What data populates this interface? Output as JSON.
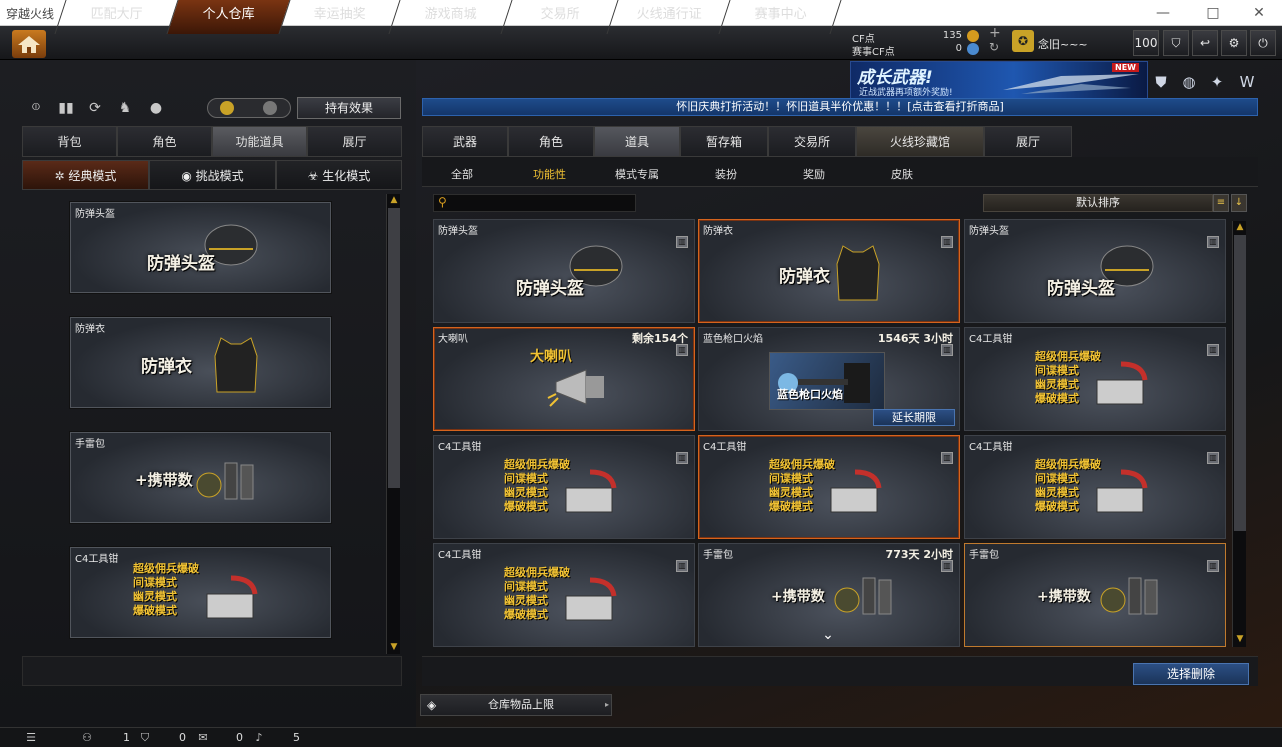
{
  "window": {
    "title": "穿越火线",
    "minimize": "—",
    "maximize": "□",
    "close": "✕"
  },
  "nav": {
    "home_icon": "home-icon",
    "tabs": [
      "匹配大厅",
      "个人仓库",
      "幸运抽奖",
      "游戏商城",
      "交易所",
      "火线通行证",
      "赛事中心"
    ],
    "active": "个人仓库"
  },
  "currency": {
    "cf_label": "CF点",
    "cf_value": "135",
    "event_label": "赛事CF点",
    "event_value": "0",
    "plus": "+",
    "refresh": "↻"
  },
  "user": {
    "name": "念旧~~~",
    "level": "100"
  },
  "toolbar": {
    "icons": [
      "shield-icon",
      "return-icon",
      "gear-icon",
      "power-icon"
    ]
  },
  "banner": {
    "title": "成长武器!",
    "subtitle": "近战武器再项额外奖励!",
    "badge": "NEW"
  },
  "left": {
    "effect_button": "持有效果",
    "tabs": [
      "背包",
      "角色",
      "功能道具",
      "展厅"
    ],
    "active_tab": "功能道具",
    "modes": [
      "经典模式",
      "挑战模式",
      "生化模式"
    ],
    "active_mode": "经典模式",
    "cards": [
      {
        "name": "防弹头盔",
        "title": "防弹头盔"
      },
      {
        "name": "防弹衣",
        "title": "防弹衣"
      },
      {
        "name": "手雷包",
        "title": "+携带数"
      },
      {
        "name": "C4工具钳",
        "lines": [
          "超级佣兵爆破",
          "间谍模式",
          "幽灵模式",
          "爆破模式"
        ]
      }
    ]
  },
  "notice": "怀旧庆典打折活动！！怀旧道具半价优惠！！！[点击查看打折商品]",
  "right": {
    "tabs": [
      "武器",
      "角色",
      "道具",
      "暂存箱",
      "交易所",
      "火线珍藏馆",
      "展厅"
    ],
    "active_tab": "道具",
    "subtabs": [
      "全部",
      "功能性",
      "模式专属",
      "装扮",
      "奖励",
      "皮肤"
    ],
    "active_subtab": "功能性",
    "search_placeholder": "",
    "sort_label": "默认排序",
    "items": [
      {
        "name": "防弹头盔",
        "big": "防弹头盔",
        "remain": ""
      },
      {
        "name": "防弹衣",
        "big": "防弹衣",
        "remain": ""
      },
      {
        "name": "防弹头盔",
        "big": "防弹头盔",
        "remain": ""
      },
      {
        "name": "大喇叭",
        "big": "大喇叭",
        "remain": "剩余154个"
      },
      {
        "name": "蓝色枪口火焰",
        "big": "蓝色枪口火焰",
        "remain": "1546天 3小时",
        "action": "延长期限"
      },
      {
        "name": "C4工具钳",
        "lines": [
          "超级佣兵爆破",
          "间谍模式",
          "幽灵模式",
          "爆破模式"
        ],
        "remain": ""
      },
      {
        "name": "C4工具钳",
        "lines": [
          "超级佣兵爆破",
          "间谍模式",
          "幽灵模式",
          "爆破模式"
        ],
        "remain": ""
      },
      {
        "name": "C4工具钳",
        "lines": [
          "超级佣兵爆破",
          "间谍模式",
          "幽灵模式",
          "爆破模式"
        ],
        "remain": ""
      },
      {
        "name": "C4工具钳",
        "lines": [
          "超级佣兵爆破",
          "间谍模式",
          "幽灵模式",
          "爆破模式"
        ],
        "remain": ""
      },
      {
        "name": "C4工具钳",
        "lines": [
          "超级佣兵爆破",
          "间谍模式",
          "幽灵模式",
          "爆破模式"
        ],
        "remain": ""
      },
      {
        "name": "手雷包",
        "big": "+携带数",
        "remain": "773天 2小时"
      },
      {
        "name": "手雷包",
        "big": "+携带数",
        "remain": ""
      }
    ],
    "delete_button": "选择删除",
    "capacity_label": "仓库物品上限"
  },
  "status": {
    "friends": "1",
    "guild": "0",
    "chat": "0",
    "volume": "5"
  }
}
